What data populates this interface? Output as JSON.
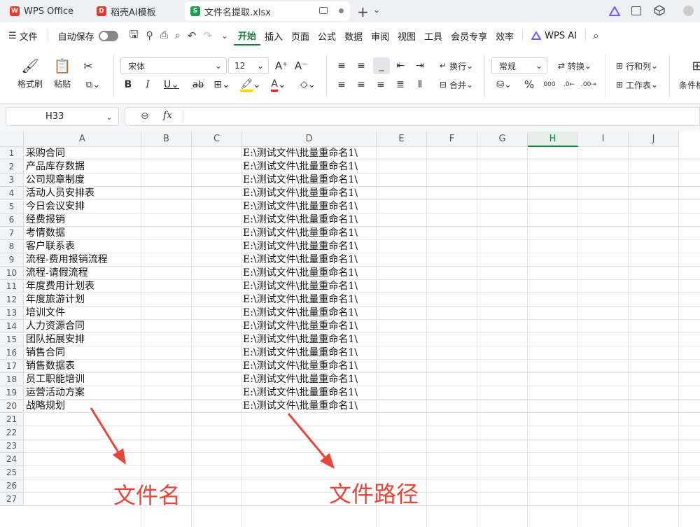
{
  "tabs": [
    {
      "label": "WPS Office",
      "icon": "wps-logo-icon"
    },
    {
      "label": "稻壳AI模板",
      "icon": "docer-logo-icon"
    },
    {
      "label": "文件名提取.xlsx",
      "icon": "spreadsheet-icon"
    }
  ],
  "menu": {
    "file": "文件",
    "autosave": "自动保存",
    "items": [
      "开始",
      "插入",
      "页面",
      "公式",
      "数据",
      "审阅",
      "视图",
      "工具",
      "会员专享",
      "效率"
    ],
    "wps_ai": "WPS AI"
  },
  "ribbon": {
    "format_painter": "格式刷",
    "paste": "粘贴",
    "font_name": "宋体",
    "font_size": "12",
    "wrap": "换行",
    "merge": "合并",
    "number_format": "常规",
    "convert": "转换",
    "row_col": "行和列",
    "worksheet": "工作表",
    "conditional": "条件格"
  },
  "formula_bar": {
    "cell_ref": "H33",
    "fx": "fx"
  },
  "columns": [
    "A",
    "B",
    "C",
    "D",
    "E",
    "F",
    "G",
    "H",
    "I",
    "J"
  ],
  "rows": [
    "1",
    "2",
    "3",
    "4",
    "5",
    "6",
    "7",
    "8",
    "9",
    "10",
    "11",
    "12",
    "13",
    "14",
    "15",
    "16",
    "17",
    "18",
    "19",
    "20",
    "21",
    "22",
    "23",
    "24",
    "25",
    "26",
    "27"
  ],
  "colA": [
    "采购合同",
    "产品库存数据",
    "公司规章制度",
    "活动人员安排表",
    "今日会议安排",
    "经费报销",
    "考情数据",
    "客户联系表",
    "流程-费用报销流程",
    "流程-请假流程",
    "年度费用计划表",
    "年度旅游计划",
    "培训文件",
    "人力资源合同",
    "团队拓展安排",
    "销售合同",
    "销售数据表",
    "员工职能培训",
    "运营活动方案",
    "战略规划"
  ],
  "colD": "E:\\测试文件\\批量重命名1\\",
  "annotations": {
    "left": "文件名",
    "right": "文件路径"
  },
  "colors": {
    "accent": "#1a7f3c",
    "annotation": "#e8463a",
    "selected_col": "#1a7f3c"
  }
}
